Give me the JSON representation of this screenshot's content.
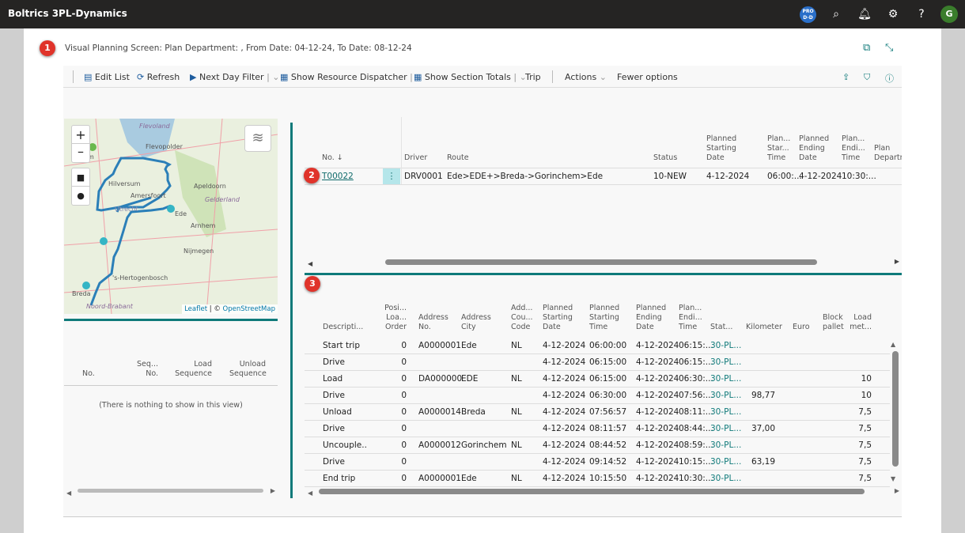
{
  "app": {
    "title": "Boltrics 3PL-Dynamics",
    "env_badge": "PRO D-D",
    "avatar": "G",
    "avatar_color": "#3a7d2c"
  },
  "page": {
    "title": "Visual Planning Screen: Plan Department: , From Date: 04-12-24, To Date: 08-12-24",
    "badges": [
      "1",
      "2",
      "3"
    ]
  },
  "toolbar": {
    "edit_list": "Edit List",
    "refresh": "Refresh",
    "next_day_filter": "Next Day Filter",
    "show_resource_dispatcher": "Show Resource Dispatcher",
    "show_section_totals": "Show Section Totals",
    "trip": "Trip",
    "actions": "Actions",
    "fewer_options": "Fewer options"
  },
  "map": {
    "attribution_leaflet": "Leaflet",
    "attribution_osm": "OpenStreetMap",
    "labels": [
      "Flevoland",
      "Flevopolder",
      "erdam",
      "Hilversum",
      "Amersfoort",
      "Utrecht",
      "Apeldoorn",
      "Gelderland",
      "Ede",
      "Arnhem",
      "Nijmegen",
      "'s-Hertogenbosch",
      "Breda",
      "Noord-Brabant"
    ]
  },
  "left_list": {
    "columns": [
      "No.",
      "Seq... No.",
      "Load Sequence",
      "Unload Sequence"
    ],
    "empty": "(There is nothing to show in this view)"
  },
  "trips": {
    "columns": [
      "No. ↓",
      "Driver",
      "Route",
      "Status",
      "Planned Starting Date",
      "Plan... Star... Time",
      "Planned Ending Date",
      "Plan... Endi... Time",
      "Plan Departm"
    ],
    "rows": [
      {
        "no": "T00022",
        "driver": "DRV0001",
        "route": "Ede>EDE+>Breda->Gorinchem>Ede",
        "status": "10-NEW",
        "psd": "4-12-2024",
        "pst": "06:00:...",
        "ped": "4-12-2024",
        "pet": "10:30:..."
      }
    ]
  },
  "stops": {
    "columns": [
      "Descripti...",
      "Posi... Loa... Order",
      "Address No.",
      "Address City",
      "Add... Cou... Code",
      "Planned Starting Date",
      "Planned Starting Time",
      "Planned Ending Date",
      "Plan... Endi... Time",
      "Stat...",
      "Kilometer",
      "Euro",
      "Block pallet",
      "Load met..."
    ],
    "rows": [
      [
        "Start trip",
        "0",
        "A0000001",
        "Ede",
        "NL",
        "4-12-2024",
        "06:00:00",
        "4-12-2024",
        "06:15:...",
        "30-PL...",
        "",
        "",
        "",
        ""
      ],
      [
        "Drive",
        "0",
        "",
        "",
        "",
        "4-12-2024",
        "06:15:00",
        "4-12-2024",
        "06:15:...",
        "30-PL...",
        "",
        "",
        "",
        ""
      ],
      [
        "Load",
        "0",
        "DA000000",
        "EDE",
        "NL",
        "4-12-2024",
        "06:15:00",
        "4-12-2024",
        "06:30:...",
        "30-PL...",
        "",
        "",
        "",
        "10"
      ],
      [
        "Drive",
        "0",
        "",
        "",
        "",
        "4-12-2024",
        "06:30:00",
        "4-12-2024",
        "07:56:...",
        "30-PL...",
        "98,77",
        "",
        "",
        "10"
      ],
      [
        "Unload",
        "0",
        "A0000014",
        "Breda",
        "NL",
        "4-12-2024",
        "07:56:57",
        "4-12-2024",
        "08:11:...",
        "30-PL...",
        "",
        "",
        "",
        "7,5"
      ],
      [
        "Drive",
        "0",
        "",
        "",
        "",
        "4-12-2024",
        "08:11:57",
        "4-12-2024",
        "08:44:...",
        "30-PL...",
        "37,00",
        "",
        "",
        "7,5"
      ],
      [
        "Uncouple..",
        "0",
        "A0000012",
        "Gorinchem",
        "NL",
        "4-12-2024",
        "08:44:52",
        "4-12-2024",
        "08:59:...",
        "30-PL...",
        "",
        "",
        "",
        "7,5"
      ],
      [
        "Drive",
        "0",
        "",
        "",
        "",
        "4-12-2024",
        "09:14:52",
        "4-12-2024",
        "10:15:...",
        "30-PL...",
        "63,19",
        "",
        "",
        "7,5"
      ],
      [
        "End trip",
        "0",
        "A0000001",
        "Ede",
        "NL",
        "4-12-2024",
        "10:15:50",
        "4-12-2024",
        "10:30:...",
        "30-PL...",
        "",
        "",
        "",
        "7,5"
      ]
    ]
  }
}
